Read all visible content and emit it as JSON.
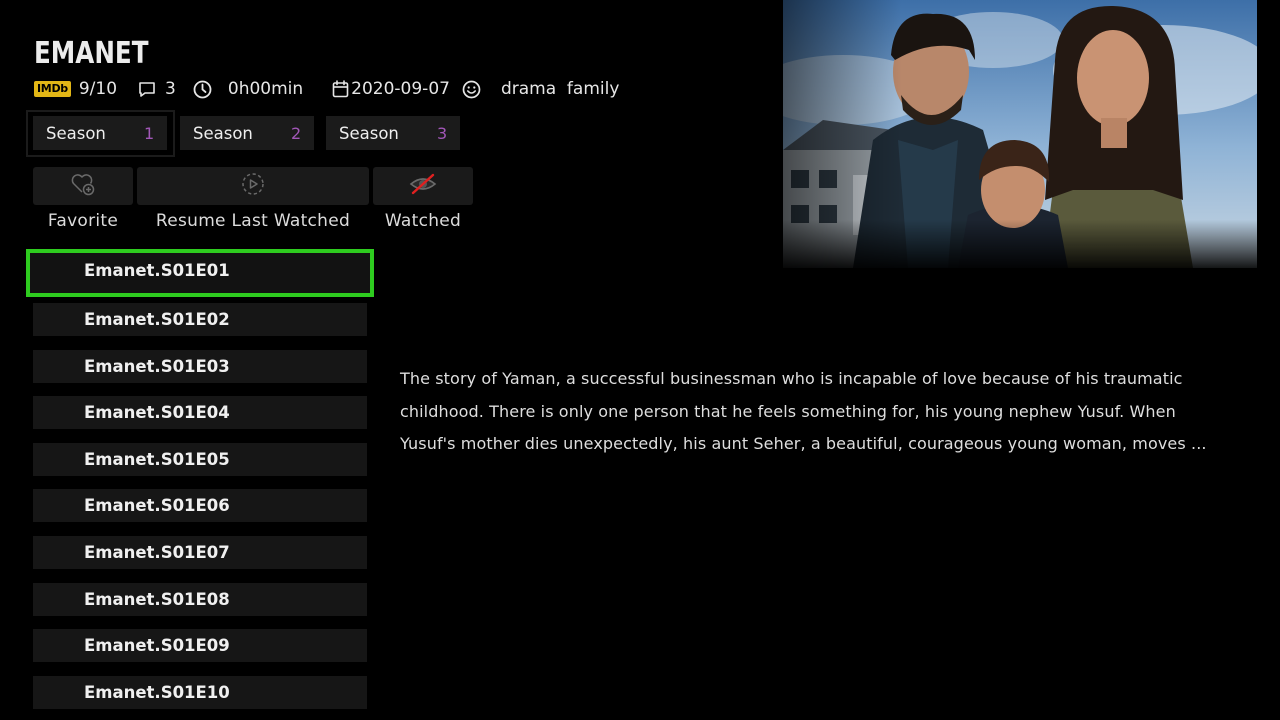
{
  "show": {
    "title": "EMANET",
    "imdb_badge": "IMDb",
    "rating": "9/10",
    "comments_count": "3",
    "duration": "0h00min",
    "release_date": "2020-09-07",
    "genres": "drama  family"
  },
  "seasons": [
    {
      "label": "Season",
      "number": "1",
      "selected": true
    },
    {
      "label": "Season",
      "number": "2",
      "selected": false
    },
    {
      "label": "Season",
      "number": "3",
      "selected": false
    }
  ],
  "actions": {
    "favorite": "Favorite",
    "resume": "Resume Last Watched",
    "watched": "Watched"
  },
  "episodes": [
    "Emanet.S01E01",
    "Emanet.S01E02",
    "Emanet.S01E03",
    "Emanet.S01E04",
    "Emanet.S01E05",
    "Emanet.S01E06",
    "Emanet.S01E07",
    "Emanet.S01E08",
    "Emanet.S01E09",
    "Emanet.S01E10"
  ],
  "focused_episode": 0,
  "description": "The story of Yaman, a successful businessman who is incapable of love because of his traumatic childhood. There is only one person that he feels something for, his young nephew Yusuf. When Yusuf's mother dies unexpectedly, his aunt Seher, a beautiful, courageous young woman, moves ...",
  "icons": {
    "comments": "comment-icon",
    "duration": "clock-icon",
    "date": "calendar-icon",
    "genre": "smiley-icon",
    "favorite": "heart-plus-icon",
    "resume": "play-circle-icon",
    "watched": "eye-slash-icon"
  },
  "colors": {
    "background": "#000000",
    "imdb": "#e2b616",
    "season_number": "#a257b8",
    "focus_border": "#2ecc1f",
    "watched_icon": "#e02020"
  }
}
